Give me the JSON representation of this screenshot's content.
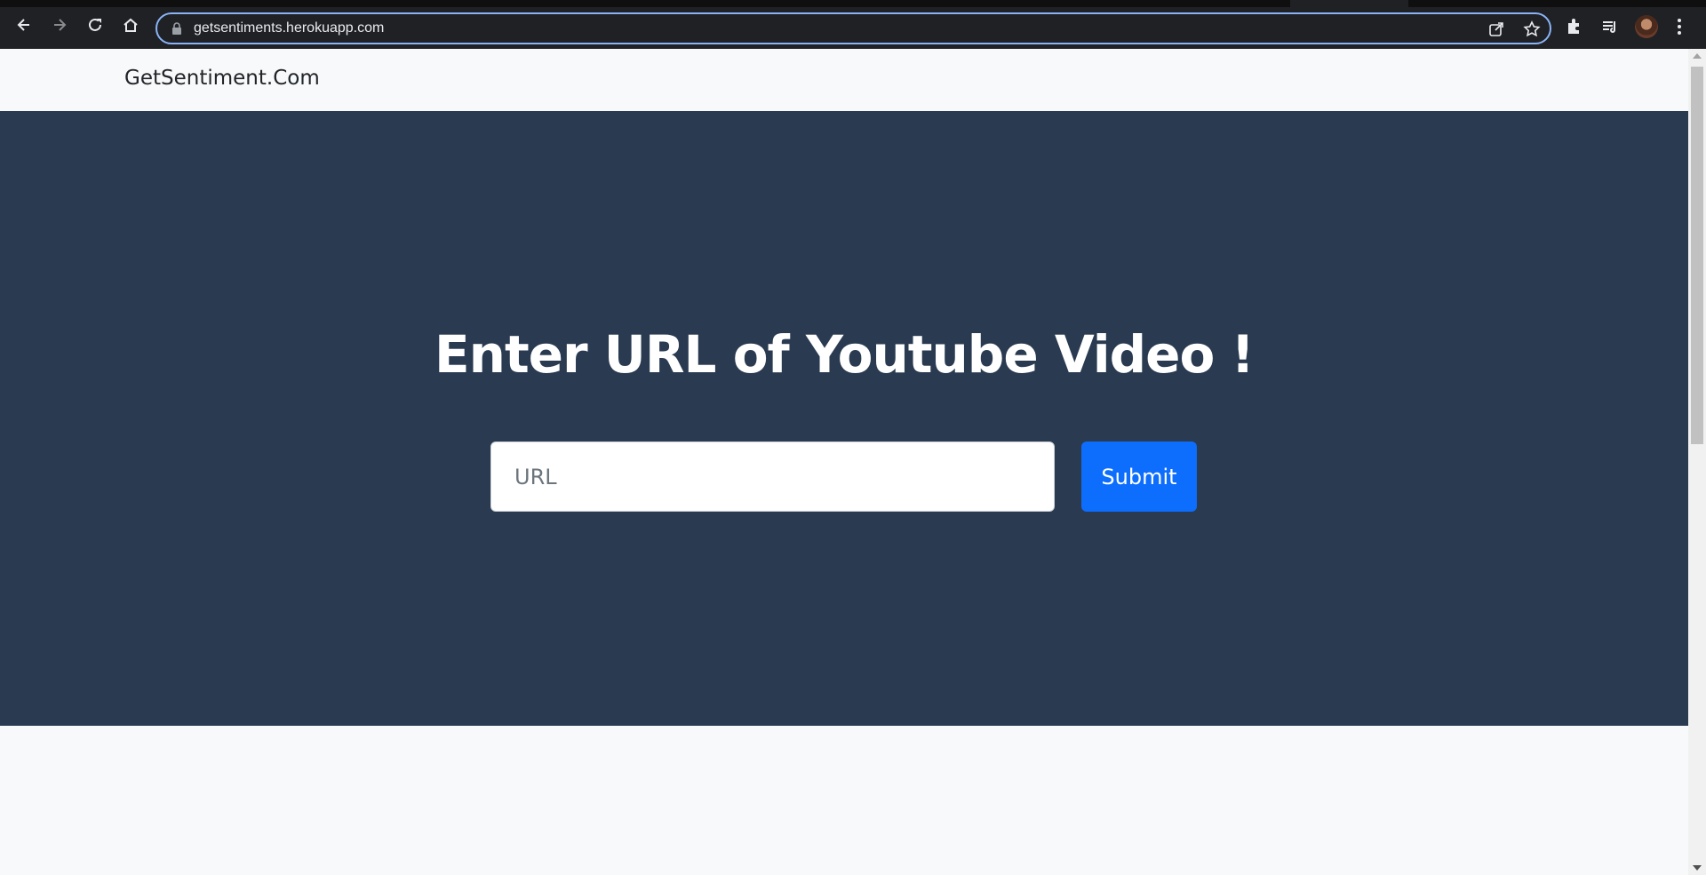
{
  "browser": {
    "url": "getsentiments.herokuapp.com",
    "icons": [
      "back-icon",
      "forward-icon",
      "reload-icon",
      "home-icon",
      "lock-icon",
      "share-icon",
      "bookmark-star-icon",
      "extensions-icon",
      "media-queue-icon",
      "avatar",
      "kebab-menu-icon"
    ]
  },
  "site": {
    "brand": "GetSentiment.Com"
  },
  "hero": {
    "title": "Enter URL of Youtube Video !",
    "input_placeholder": "URL",
    "input_value": "",
    "submit_label": "Submit"
  },
  "colors": {
    "hero_bg": "#293a51",
    "submit_bg": "#0d6efd",
    "page_bg": "#f8f9fa",
    "browser_bar": "#202124",
    "focus_ring": "#8ab4f8"
  }
}
